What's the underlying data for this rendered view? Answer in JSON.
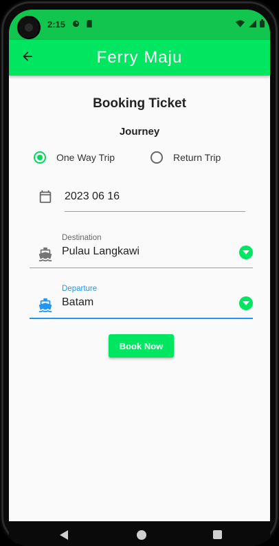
{
  "status_bar": {
    "time": "2:15",
    "icons_left": [
      "media-icon",
      "sd-card-icon"
    ],
    "icons_right": [
      "wifi-icon",
      "signal-icon",
      "battery-icon"
    ]
  },
  "app_bar": {
    "title": "Ferry Maju",
    "back_icon": "arrow-back-icon"
  },
  "page": {
    "title": "Booking Ticket",
    "section": "Journey"
  },
  "trip_type": {
    "options": [
      {
        "label": "One Way Trip",
        "selected": true
      },
      {
        "label": "Return Trip",
        "selected": false
      }
    ]
  },
  "date_field": {
    "icon": "calendar-icon",
    "value": "2023 06 16"
  },
  "destination": {
    "label": "Destination",
    "value": "Pulau Langkawi",
    "icon": "ferry-icon"
  },
  "departure": {
    "label": "Departure",
    "value": "Batam",
    "icon": "ferry-icon",
    "focused": true
  },
  "book_button": {
    "label": "Book Now"
  },
  "colors": {
    "status_bar": "#12c54f",
    "app_bar": "#00e660",
    "accent": "#00e660",
    "focus": "#2196f3",
    "background": "#fafafa"
  }
}
